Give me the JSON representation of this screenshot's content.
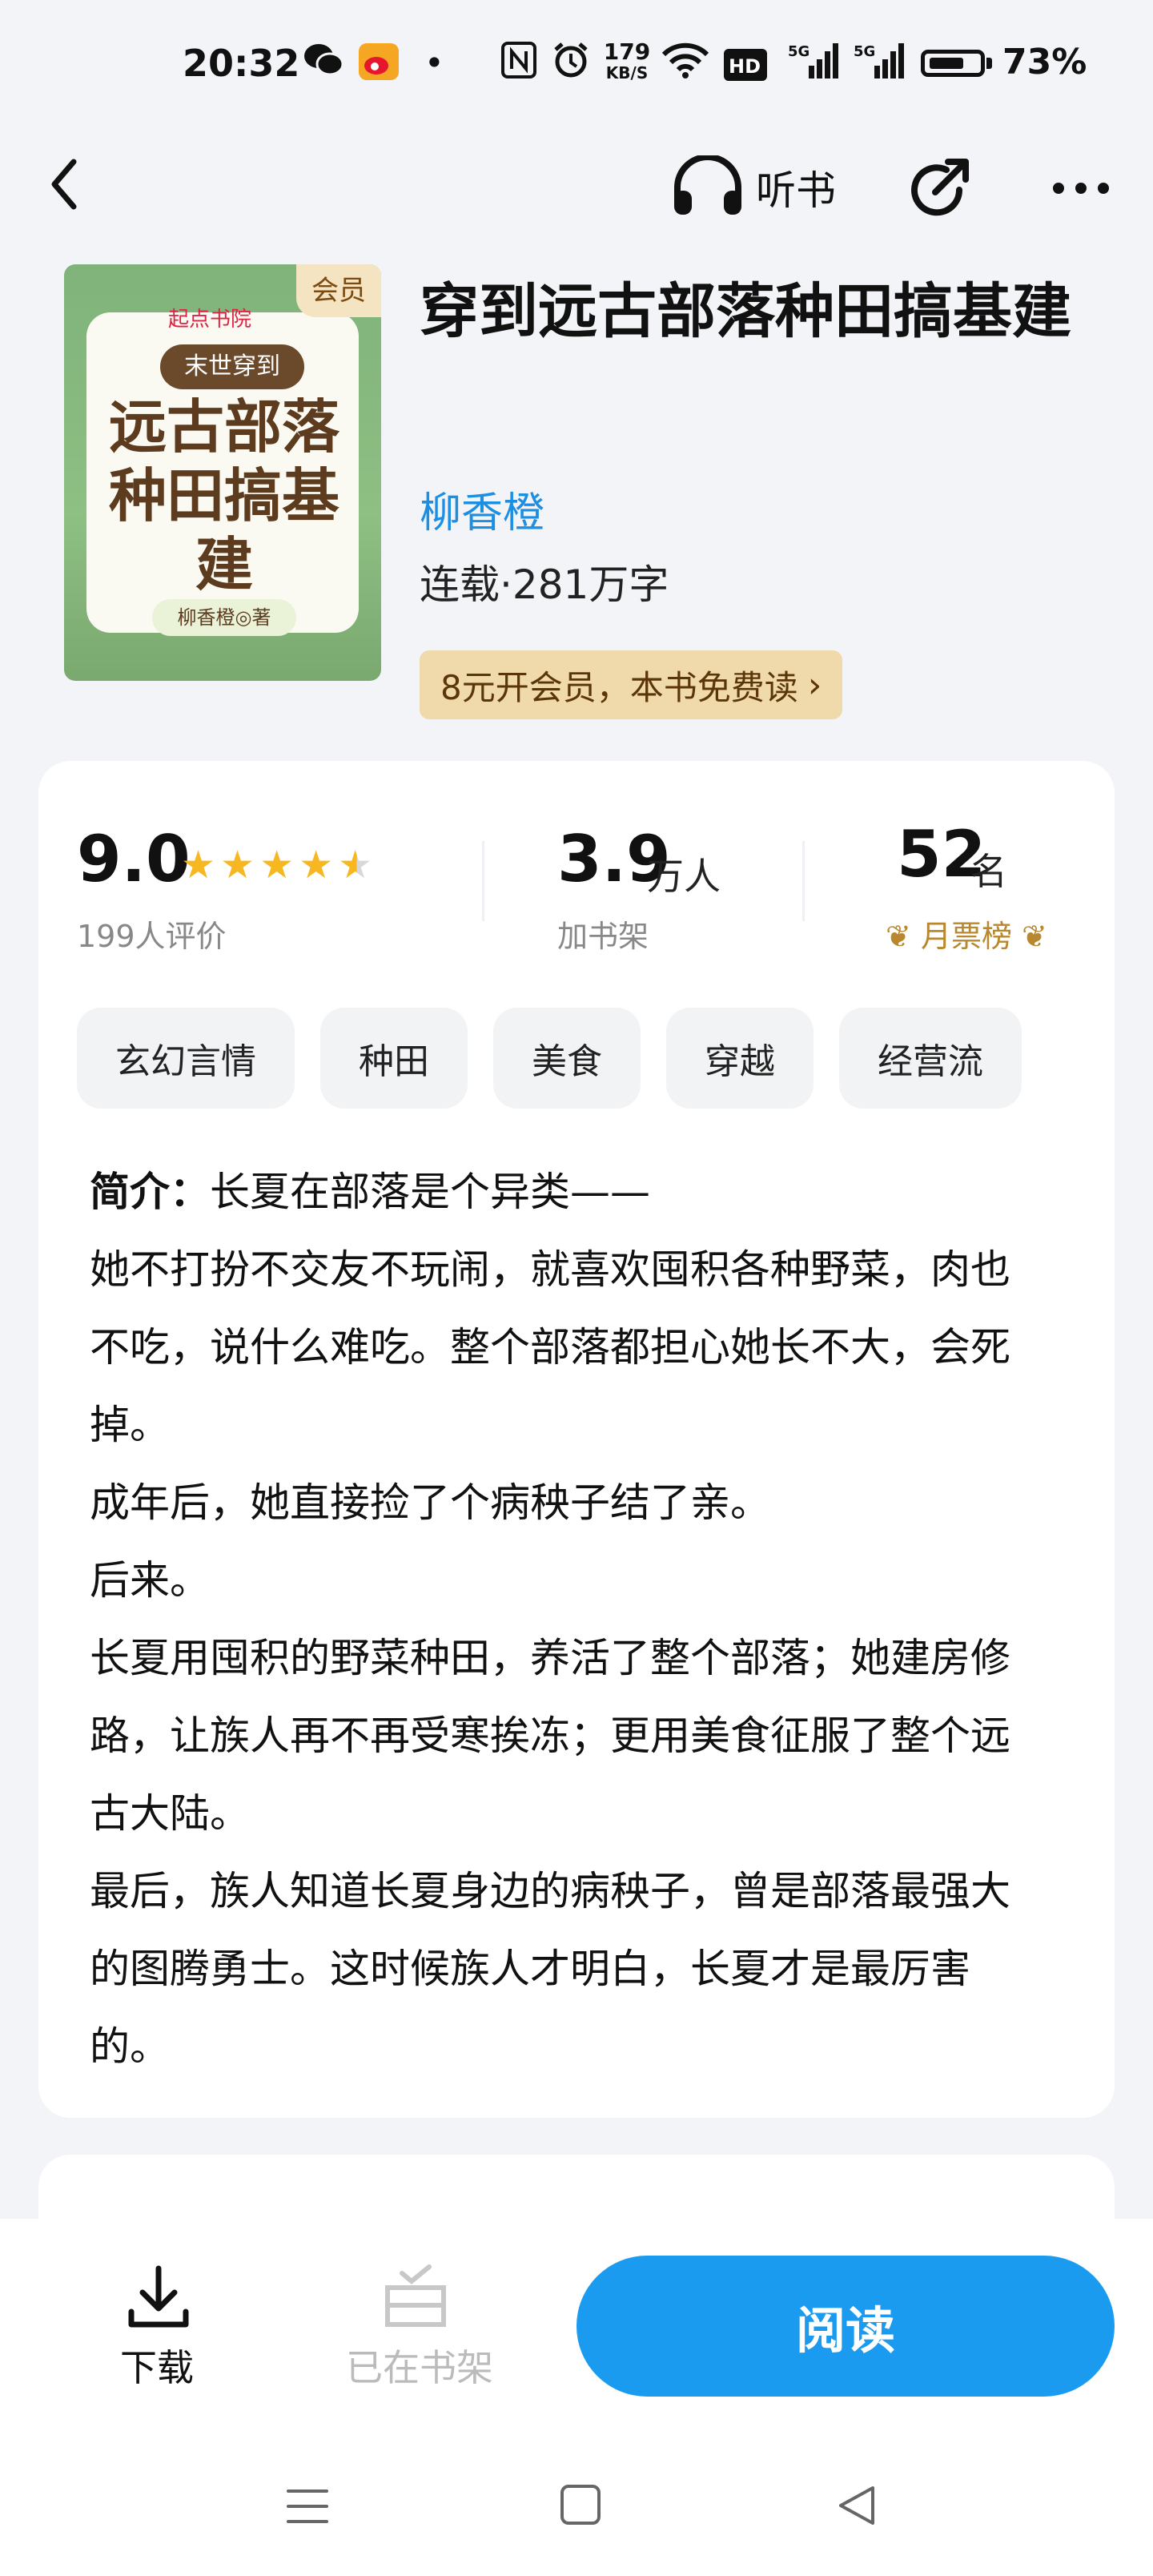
{
  "status_bar": {
    "time": "20:32",
    "speed": "179",
    "speed_unit": "KB/S",
    "battery": "73%",
    "battery_level": 0.73
  },
  "nav": {
    "listen_label": "听书"
  },
  "book": {
    "cover_brand": "起点书院",
    "cover_subtitle": "末世穿到",
    "cover_title": "远古部落种田搞基建",
    "cover_author": "柳香橙◎著",
    "vip_tag": "会员",
    "title": "穿到远古部落种田搞基建",
    "author": "柳香橙",
    "status": "连载·281万字",
    "vip_promo": "8元开会员，本书免费读",
    "vip_promo_arrow": "›"
  },
  "stats": {
    "rating": "9.0",
    "rating_stars": 4.5,
    "rating_count": "199人评价",
    "shelf_count": "3.9",
    "shelf_unit": "万人",
    "shelf_label": "加书架",
    "rank": "52",
    "rank_unit": "名",
    "rank_label": "月票榜"
  },
  "tags": [
    "玄幻言情",
    "种田",
    "美食",
    "穿越",
    "经营流"
  ],
  "intro": {
    "label": "简介：",
    "first_line": "长夏在部落是个异类——",
    "paragraphs": [
      "她不打扮不交友不玩闹，就喜欢囤积各种野菜，肉也不吃，说什么难吃。整个部落都担心她长不大，会死掉。",
      "成年后，她直接捡了个病秧子结了亲。",
      "后来。",
      "长夏用囤积的野菜种田，养活了整个部落；她建房修路，让族人再不再受寒挨冻；更用美食征服了整个远古大陆。",
      "最后，族人知道长夏身边的病秧子，曾是部落最强大的图腾勇士。这时候族人才明白，长夏才是最厉害的。"
    ]
  },
  "bottom_bar": {
    "download_label": "下载",
    "shelf_label": "已在书架",
    "read_label": "阅读"
  },
  "colors": {
    "accent": "#1a9bf0",
    "author_link": "#1c8fe3",
    "star": "#f7b720",
    "rank_gold": "#b8872e",
    "vip_bg": "#f0d9aa"
  }
}
